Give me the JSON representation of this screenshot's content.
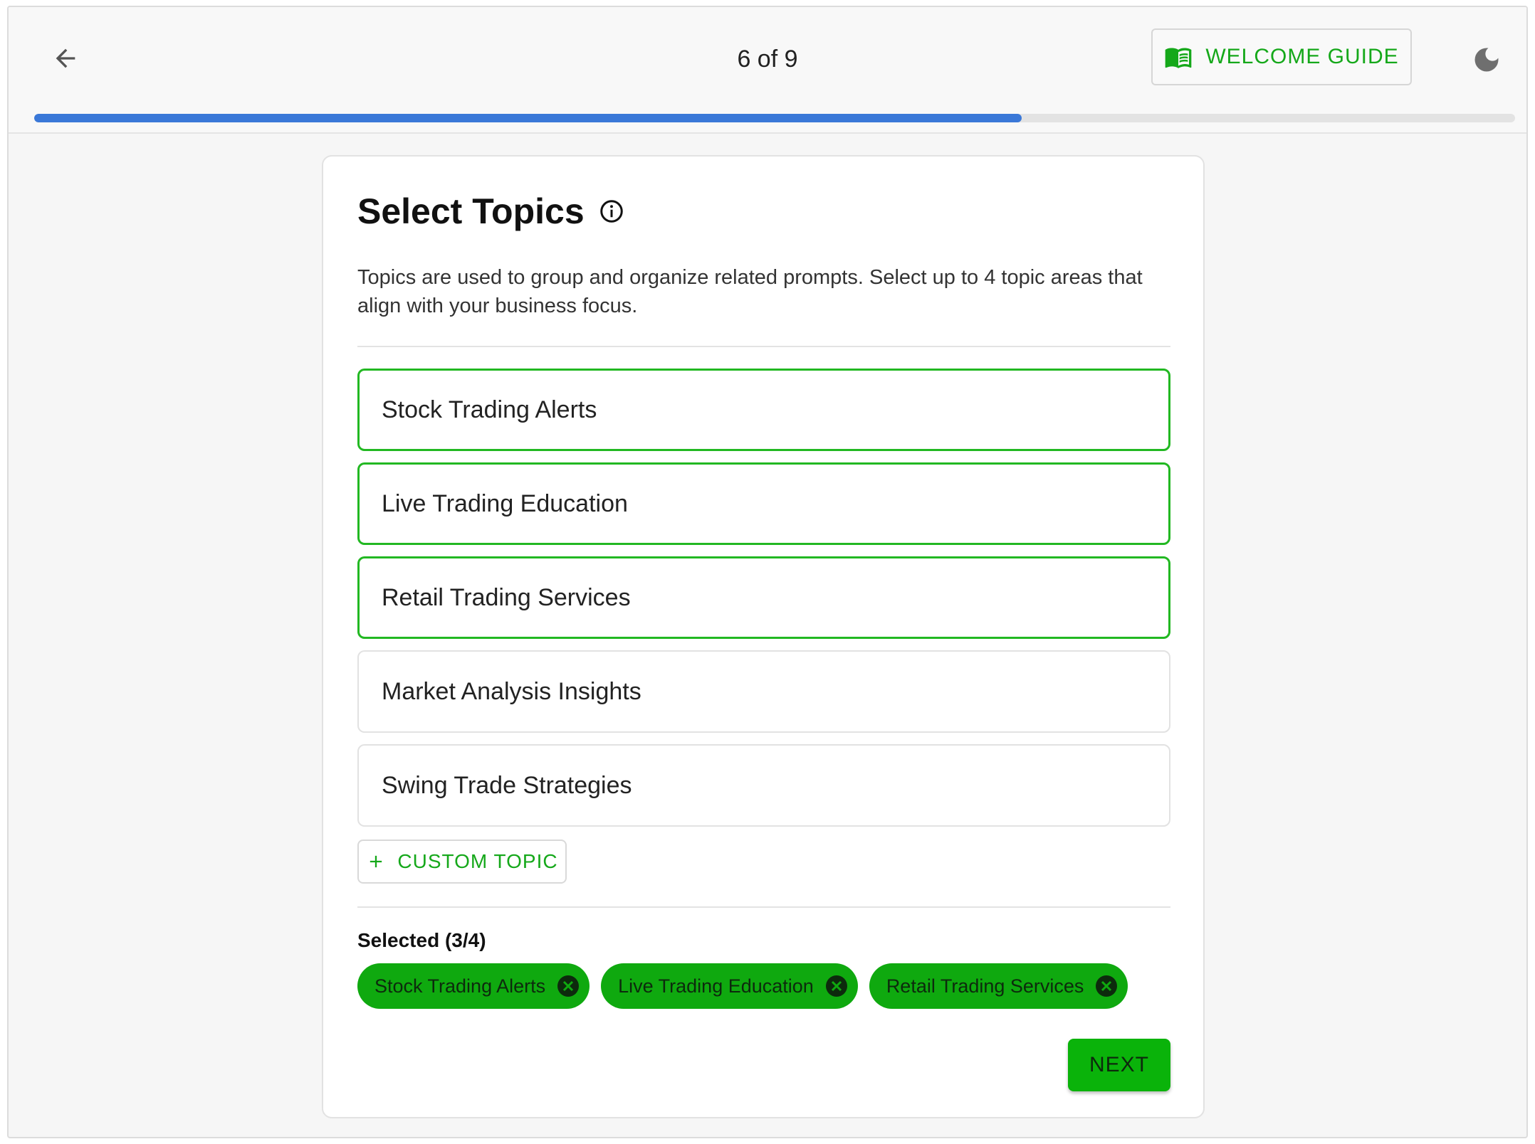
{
  "header": {
    "step_counter": "6 of 9",
    "welcome_guide_label": "WELCOME GUIDE",
    "progress_fraction": 0.667
  },
  "card": {
    "title": "Select Topics",
    "description": "Topics are used to group and organize related prompts. Select up to 4 topic areas that align with your business focus.",
    "topics": [
      {
        "label": "Stock Trading Alerts",
        "selected": true
      },
      {
        "label": "Live Trading Education",
        "selected": true
      },
      {
        "label": "Retail Trading Services",
        "selected": true
      },
      {
        "label": "Market Analysis Insights",
        "selected": false
      },
      {
        "label": "Swing Trade Strategies",
        "selected": false
      }
    ],
    "custom_topic_label": "CUSTOM TOPIC",
    "selected_label": "Selected (3/4)",
    "selected_chips": [
      "Stock Trading Alerts",
      "Live Trading Education",
      "Retail Trading Services"
    ],
    "next_label": "NEXT"
  },
  "colors": {
    "accent_green": "#15a81a",
    "chip_green": "#0fa90f",
    "progress_blue": "#3a78d8"
  },
  "icons": {
    "back": "arrow-left-icon",
    "guide": "book-icon",
    "theme": "moon-icon",
    "info": "info-icon",
    "add": "plus-icon",
    "remove": "close-circle-icon"
  }
}
